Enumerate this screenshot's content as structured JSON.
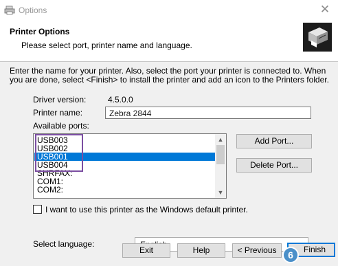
{
  "window": {
    "title": "Options"
  },
  "header": {
    "title": "Printer Options",
    "subtitle": "Please select port, printer name and language."
  },
  "intro": "Enter the name for your printer. Also, select the port your printer is connected to. When you are done, select <Finish> to install the printer and add an icon to the Printers folder.",
  "fields": {
    "driver_version_label": "Driver version:",
    "driver_version_value": "4.5.0.0",
    "printer_name_label": "Printer name:",
    "printer_name_value": "Zebra 2844",
    "available_ports_label": "Available ports:"
  },
  "ports": [
    {
      "name": "USB003",
      "selected": false
    },
    {
      "name": "USB002",
      "selected": false
    },
    {
      "name": "USB001",
      "selected": true
    },
    {
      "name": "USB004",
      "selected": false
    },
    {
      "name": "SHRFAX:",
      "selected": false
    },
    {
      "name": "COM1:",
      "selected": false
    },
    {
      "name": "COM2:",
      "selected": false
    }
  ],
  "buttons": {
    "add_port": "Add Port...",
    "delete_port": "Delete Port...",
    "exit": "Exit",
    "help": "Help",
    "previous": "< Previous",
    "finish": "Finish"
  },
  "default_printer_checkbox": {
    "label": "I want to use this printer as the Windows default printer.",
    "checked": false
  },
  "language": {
    "label": "Select language:",
    "value": "English"
  },
  "annotation": {
    "step_number": "6"
  },
  "colors": {
    "selection": "#0078d7",
    "highlight_box": "#7b4ea1",
    "step_badge": "#4b90c9"
  }
}
